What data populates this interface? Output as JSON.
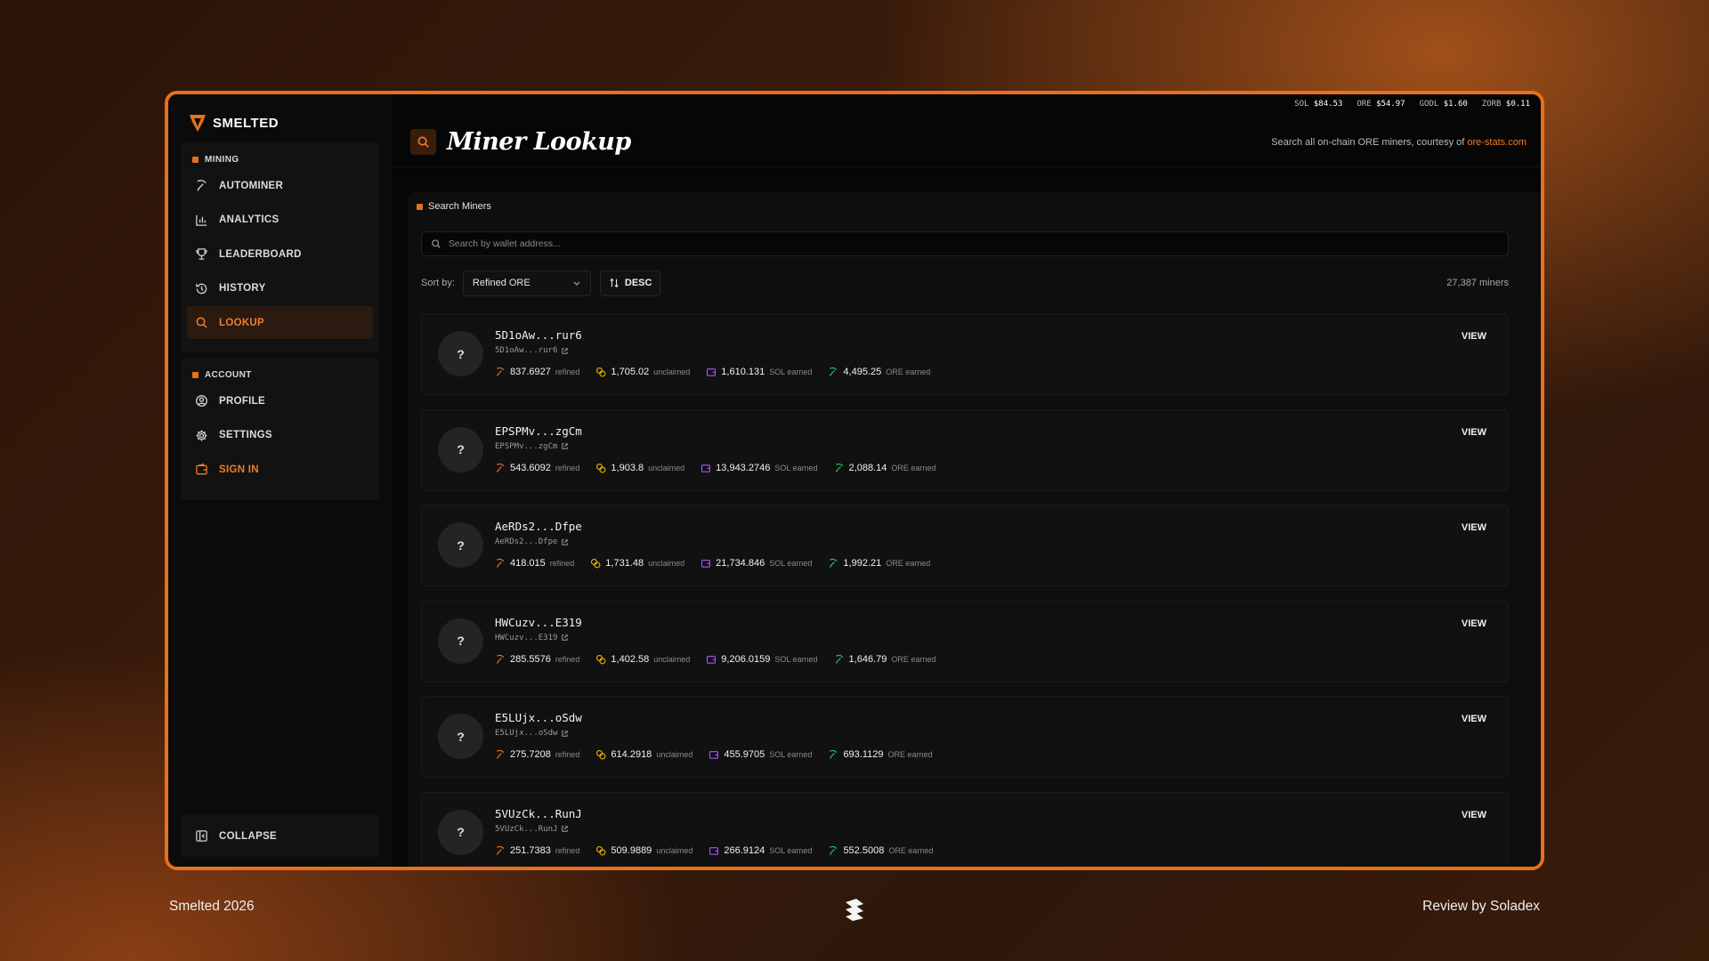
{
  "brand": {
    "name": "SMELTED"
  },
  "ticker": [
    {
      "sym": "SOL",
      "price": "$84.53"
    },
    {
      "sym": "ORE",
      "price": "$54.97"
    },
    {
      "sym": "GODL",
      "price": "$1.60"
    },
    {
      "sym": "ZORB",
      "price": "$0.11"
    }
  ],
  "sidebar": {
    "mining_label": "MINING",
    "mining_items": [
      {
        "label": "AUTOMINER",
        "icon": "pickaxe-icon"
      },
      {
        "label": "ANALYTICS",
        "icon": "bar-chart-icon"
      },
      {
        "label": "LEADERBOARD",
        "icon": "trophy-icon"
      },
      {
        "label": "HISTORY",
        "icon": "history-icon"
      },
      {
        "label": "LOOKUP",
        "icon": "search-icon",
        "active": true
      }
    ],
    "account_label": "ACCOUNT",
    "account_items": [
      {
        "label": "PROFILE",
        "icon": "user-circle-icon"
      },
      {
        "label": "SETTINGS",
        "icon": "gear-icon"
      },
      {
        "label": "SIGN IN",
        "icon": "wallet-icon"
      }
    ],
    "collapse_label": "COLLAPSE"
  },
  "header": {
    "title": "Miner Lookup",
    "description": "Search all on-chain ORE miners, courtesy of ",
    "link_text": "ore-stats.com"
  },
  "panel": {
    "title": "Search Miners",
    "search_placeholder": "Search by wallet address...",
    "sort_label": "Sort by:",
    "sort_value": "Refined ORE",
    "sort_direction": "DESC",
    "count": "27,387 miners",
    "view_label": "VIEW",
    "labels": {
      "refined": "refined",
      "unclaimed": "unclaimed",
      "sol": "SOL earned",
      "ore": "ORE earned"
    }
  },
  "miners": [
    {
      "avatar": "?",
      "name": "5D1oAw...rur6",
      "addr": "5D1oAw...rur6",
      "refined": "837.6927",
      "unclaimed": "1,705.02",
      "sol": "1,610.131",
      "ore": "4,495.25"
    },
    {
      "avatar": "?",
      "name": "EPSPMv...zgCm",
      "addr": "EPSPMv...zgCm",
      "refined": "543.6092",
      "unclaimed": "1,903.8",
      "sol": "13,943.2746",
      "ore": "2,088.14"
    },
    {
      "avatar": "?",
      "name": "AeRDs2...Dfpe",
      "addr": "AeRDs2...Dfpe",
      "refined": "418.015",
      "unclaimed": "1,731.48",
      "sol": "21,734.846",
      "ore": "1,992.21"
    },
    {
      "avatar": "?",
      "name": "HWCuzv...E319",
      "addr": "HWCuzv...E319",
      "refined": "285.5576",
      "unclaimed": "1,402.58",
      "sol": "9,206.0159",
      "ore": "1,646.79"
    },
    {
      "avatar": "?",
      "name": "E5LUjx...oSdw",
      "addr": "E5LUjx...oSdw",
      "refined": "275.7208",
      "unclaimed": "614.2918",
      "sol": "455.9705",
      "ore": "693.1129"
    },
    {
      "avatar": "?",
      "name": "5VUzCk...RunJ",
      "addr": "5VUzCk...RunJ",
      "refined": "251.7383",
      "unclaimed": "509.9889",
      "sol": "266.9124",
      "ore": "552.5008"
    }
  ],
  "footer": {
    "left": "Smelted 2026",
    "right": "Review by Soladex"
  },
  "colors": {
    "accent": "#e8701a",
    "sol": "#a855f7",
    "ore": "#22c55e",
    "unclaimed": "#eab308"
  }
}
